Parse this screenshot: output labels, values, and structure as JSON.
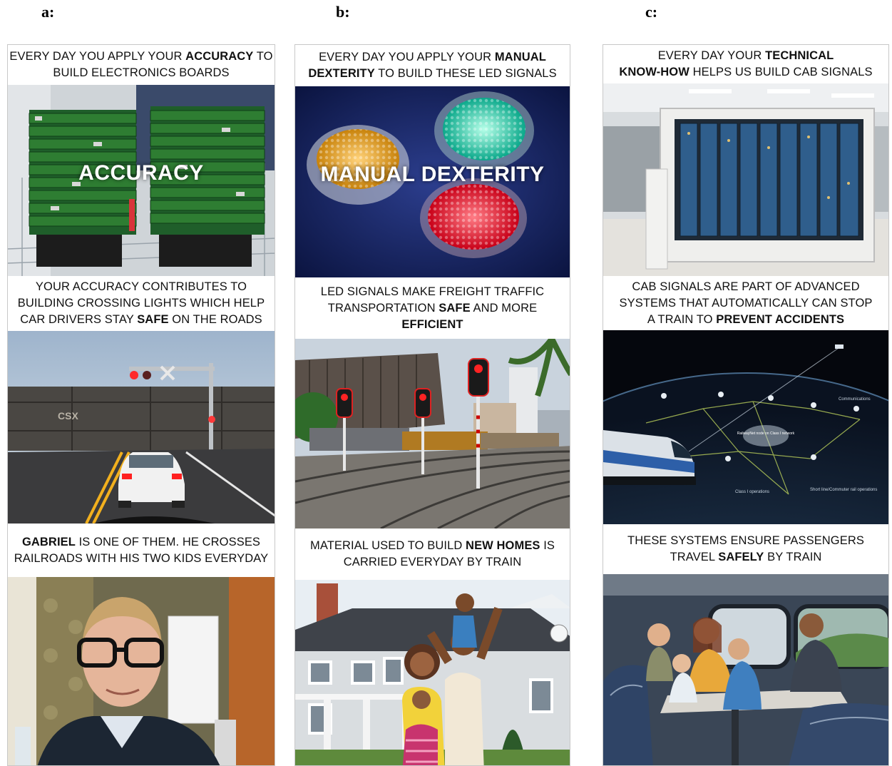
{
  "panel_labels": [
    "a:",
    "b:",
    "c:"
  ],
  "col_a": {
    "cap1": [
      "EVERY DAY YOU APPLY YOUR ",
      "ACCURACY",
      " TO",
      "BUILD ELECTRONICS BOARDS"
    ],
    "overlay": "ACCURACY",
    "cap2": [
      "YOUR ACCURACY CONTRIBUTES TO",
      "BUILDING CROSSING LIGHTS WHICH HELP",
      "CAR DRIVERS STAY ",
      "SAFE",
      " ON THE ROADS"
    ],
    "railcar_text": "CSX",
    "cap3": [
      "GABRIEL",
      " IS ONE OF THEM. HE CROSSES",
      "RAILROADS WITH HIS TWO KIDS EVERYDAY"
    ]
  },
  "col_b": {
    "cap1": [
      "EVERY DAY YOU APPLY YOUR ",
      "MANUAL",
      "DEXTERITY",
      " TO BUILD THESE LED SIGNALS"
    ],
    "overlay": "MANUAL DEXTERITY",
    "cap2": [
      "LED SIGNALS MAKE FREIGHT TRAFFIC",
      "TRANSPORTATION ",
      "SAFE",
      " AND MORE",
      "EFFICIENT"
    ],
    "cap3": [
      "MATERIAL USED TO BUILD ",
      "NEW HOMES",
      " IS",
      "CARRIED EVERYDAY BY TRAIN"
    ]
  },
  "col_c": {
    "cap1": [
      "EVERY DAY YOUR ",
      "TECHNICAL",
      "KNOW-HOW",
      " HELPS US BUILD CAB SIGNALS"
    ],
    "cap2": [
      "CAB SIGNALS ARE PART OF ADVANCED",
      "SYSTEMS THAT AUTOMATICALLY CAN STOP",
      "A TRAIN TO ",
      "PREVENT ACCIDENTS"
    ],
    "map_labels": [
      "Communications",
      "RailwayNet node on Class I network",
      "Class I operations",
      "Short line/Commuter rail operations"
    ],
    "cap3": [
      "THESE SYSTEMS ENSURE PASSENGERS",
      "TRAVEL ",
      "SAFELY",
      " BY TRAIN"
    ]
  },
  "colors": {
    "pcb_green": "#2e7d32",
    "led_amber": "#f6a821",
    "led_green": "#1de9b6",
    "led_red": "#ff1f2e",
    "sky": "#b8c7d8",
    "space": "#0a0f1a"
  }
}
